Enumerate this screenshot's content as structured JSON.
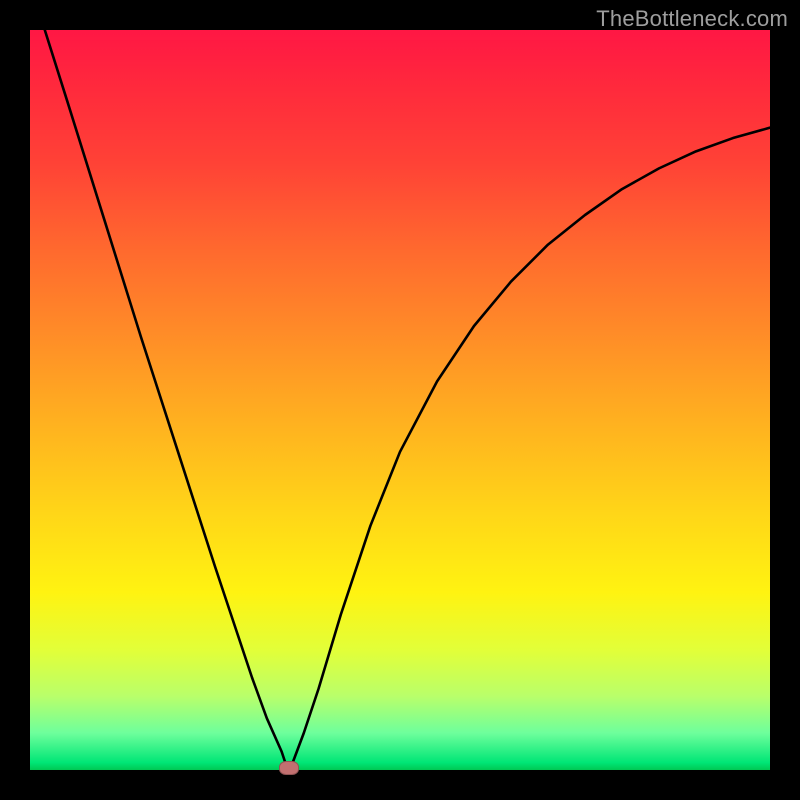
{
  "watermark": "TheBottleneck.com",
  "chart_data": {
    "type": "line",
    "title": "",
    "xlabel": "",
    "ylabel": "",
    "xlim": [
      0,
      1
    ],
    "ylim": [
      0,
      1
    ],
    "series": [
      {
        "name": "curve",
        "x": [
          0.02,
          0.05,
          0.1,
          0.15,
          0.2,
          0.25,
          0.28,
          0.3,
          0.32,
          0.34,
          0.345,
          0.35,
          0.355,
          0.37,
          0.39,
          0.42,
          0.46,
          0.5,
          0.55,
          0.6,
          0.65,
          0.7,
          0.75,
          0.8,
          0.85,
          0.9,
          0.95,
          1.0
        ],
        "y": [
          1.0,
          0.905,
          0.745,
          0.585,
          0.43,
          0.275,
          0.185,
          0.125,
          0.07,
          0.025,
          0.01,
          0.003,
          0.01,
          0.05,
          0.11,
          0.21,
          0.33,
          0.43,
          0.525,
          0.6,
          0.66,
          0.71,
          0.75,
          0.785,
          0.813,
          0.836,
          0.854,
          0.868
        ]
      }
    ],
    "marker": {
      "x": 0.35,
      "y": 0.003,
      "color": "#c27070"
    },
    "gradient_stops": [
      {
        "pos": 0.0,
        "color": "#ff1744"
      },
      {
        "pos": 0.3,
        "color": "#ff6a2e"
      },
      {
        "pos": 0.55,
        "color": "#ffb41f"
      },
      {
        "pos": 0.76,
        "color": "#fff311"
      },
      {
        "pos": 0.9,
        "color": "#b9ff6a"
      },
      {
        "pos": 1.0,
        "color": "#00c853"
      }
    ]
  }
}
